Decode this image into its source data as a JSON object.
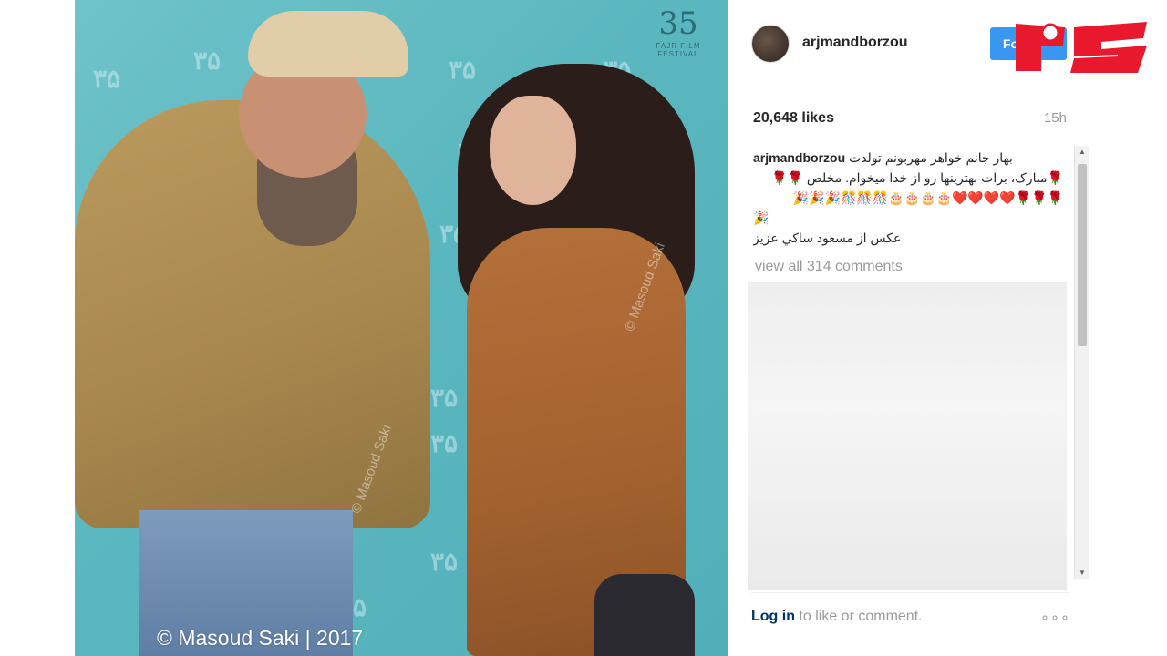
{
  "photo": {
    "watermark": "© Masoud Saki | 2017",
    "side_watermark": "© Masoud Saki",
    "festival_number": "35",
    "festival_name": "FAJR FILM FESTIVAL",
    "pattern_glyph": "۳۵"
  },
  "post": {
    "username": "arjmandborzou",
    "follow_label": "Fo",
    "likes": "20,648 likes",
    "time": "15h",
    "caption_user": "arjmandborzou",
    "caption_line1": "بهار جانم خواهر مهربونم تولدت",
    "caption_line2": "🌹مبارک، برات بهترینها رو از خدا میخوام. مخلص 🌹🌹",
    "caption_line3": "🌹🌹🌹❤️❤️❤️❤️🎂🎂🎂🎂🎊🎊🎊🎉🎉🎉",
    "caption_line4": "🎉",
    "caption_line5": "عکس از مسعود ساکي عزيز",
    "view_all": "view all 314 comments",
    "login_link": "Log in",
    "login_rest": " to like or comment.",
    "more": "∘∘∘"
  },
  "colors": {
    "follow": "#3897f0",
    "brand_red": "#e8192c",
    "backdrop": "#5bb7bf"
  }
}
